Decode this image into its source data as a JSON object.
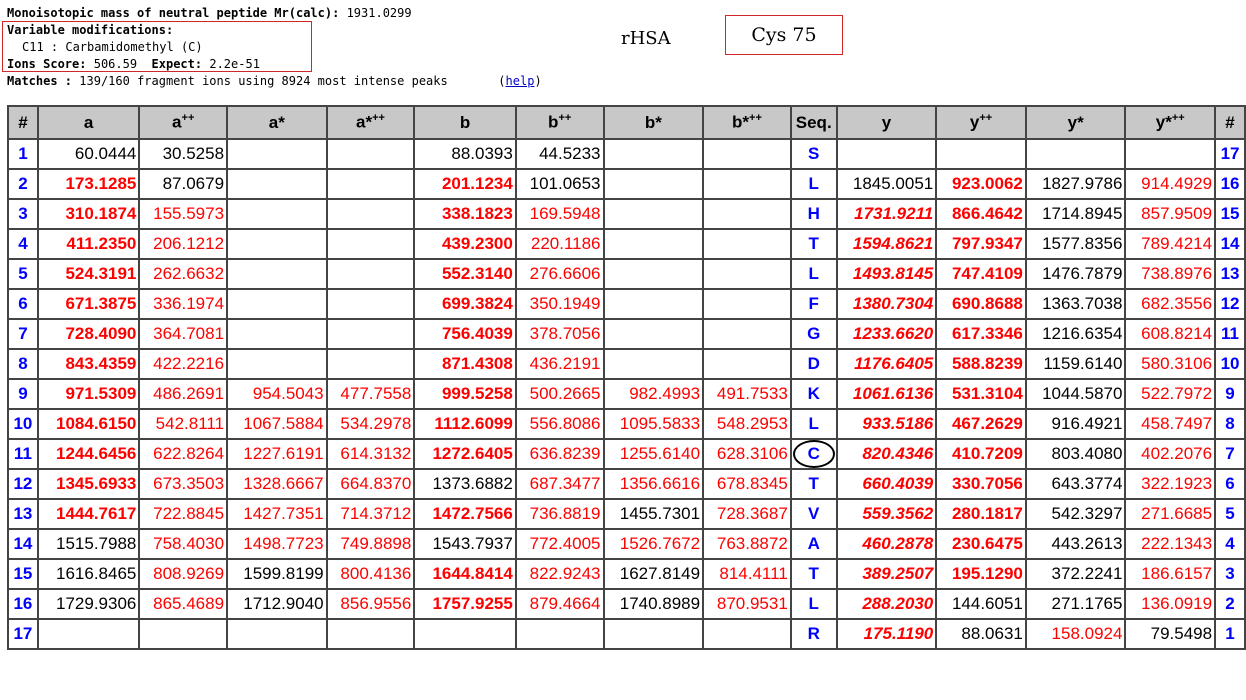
{
  "header": {
    "mass_label": "Monoisotopic mass of neutral peptide Mr(calc):",
    "mass_value": "1931.0299",
    "varmod_label": "Variable modifications:",
    "varmod_value": "C11 : Carbamidomethyl (C)",
    "score_label": "Ions Score:",
    "score_value": "506.59",
    "expect_label": "Expect:",
    "expect_value": "2.2e-51",
    "matches_label": "Matches :",
    "matches_value": "139/160 fragment ions using 8924 most intense peaks",
    "help_link": "help"
  },
  "protein_label": "rHSA",
  "site_label": "Cys 75",
  "accent_color": "#ff0000",
  "index_color": "#0000ff",
  "table": {
    "columns": [
      "#",
      "a",
      "a++",
      "a*",
      "a***",
      "b",
      "b++",
      "b*",
      "b***",
      "Seq.",
      "y",
      "y++",
      "y*",
      "y***",
      "#"
    ],
    "rows": [
      {
        "n": "1",
        "a": "60.0444",
        "a2": "30.5258",
        "as": "",
        "a3": "",
        "b": "88.0393",
        "b2": "44.5233",
        "bs": "",
        "b3": "",
        "seq": "S",
        "y": "",
        "y2": "",
        "ys": "",
        "y3": "",
        "n2": "17"
      },
      {
        "n": "2",
        "a": "173.1285",
        "a2": "87.0679",
        "as": "",
        "a3": "",
        "b": "201.1234",
        "b2": "101.0653",
        "bs": "",
        "b3": "",
        "seq": "L",
        "y": "1845.0051",
        "y2": "923.0062",
        "ys": "1827.9786",
        "y3": "914.4929",
        "n2": "16"
      },
      {
        "n": "3",
        "a": "310.1874",
        "a2": "155.5973",
        "as": "",
        "a3": "",
        "b": "338.1823",
        "b2": "169.5948",
        "bs": "",
        "b3": "",
        "seq": "H",
        "y": "1731.9211",
        "y2": "866.4642",
        "ys": "1714.8945",
        "y3": "857.9509",
        "n2": "15"
      },
      {
        "n": "4",
        "a": "411.2350",
        "a2": "206.1212",
        "as": "",
        "a3": "",
        "b": "439.2300",
        "b2": "220.1186",
        "bs": "",
        "b3": "",
        "seq": "T",
        "y": "1594.8621",
        "y2": "797.9347",
        "ys": "1577.8356",
        "y3": "789.4214",
        "n2": "14"
      },
      {
        "n": "5",
        "a": "524.3191",
        "a2": "262.6632",
        "as": "",
        "a3": "",
        "b": "552.3140",
        "b2": "276.6606",
        "bs": "",
        "b3": "",
        "seq": "L",
        "y": "1493.8145",
        "y2": "747.4109",
        "ys": "1476.7879",
        "y3": "738.8976",
        "n2": "13"
      },
      {
        "n": "6",
        "a": "671.3875",
        "a2": "336.1974",
        "as": "",
        "a3": "",
        "b": "699.3824",
        "b2": "350.1949",
        "bs": "",
        "b3": "",
        "seq": "F",
        "y": "1380.7304",
        "y2": "690.8688",
        "ys": "1363.7038",
        "y3": "682.3556",
        "n2": "12"
      },
      {
        "n": "7",
        "a": "728.4090",
        "a2": "364.7081",
        "as": "",
        "a3": "",
        "b": "756.4039",
        "b2": "378.7056",
        "bs": "",
        "b3": "",
        "seq": "G",
        "y": "1233.6620",
        "y2": "617.3346",
        "ys": "1216.6354",
        "y3": "608.8214",
        "n2": "11"
      },
      {
        "n": "8",
        "a": "843.4359",
        "a2": "422.2216",
        "as": "",
        "a3": "",
        "b": "871.4308",
        "b2": "436.2191",
        "bs": "",
        "b3": "",
        "seq": "D",
        "y": "1176.6405",
        "y2": "588.8239",
        "ys": "1159.6140",
        "y3": "580.3106",
        "n2": "10"
      },
      {
        "n": "9",
        "a": "971.5309",
        "a2": "486.2691",
        "as": "954.5043",
        "a3": "477.7558",
        "b": "999.5258",
        "b2": "500.2665",
        "bs": "982.4993",
        "b3": "491.7533",
        "seq": "K",
        "y": "1061.6136",
        "y2": "531.3104",
        "ys": "1044.5870",
        "y3": "522.7972",
        "n2": "9"
      },
      {
        "n": "10",
        "a": "1084.6150",
        "a2": "542.8111",
        "as": "1067.5884",
        "a3": "534.2978",
        "b": "1112.6099",
        "b2": "556.8086",
        "bs": "1095.5833",
        "b3": "548.2953",
        "seq": "L",
        "y": "933.5186",
        "y2": "467.2629",
        "ys": "916.4921",
        "y3": "458.7497",
        "n2": "8"
      },
      {
        "n": "11",
        "a": "1244.6456",
        "a2": "622.8264",
        "as": "1227.6191",
        "a3": "614.3132",
        "b": "1272.6405",
        "b2": "636.8239",
        "bs": "1255.6140",
        "b3": "628.3106",
        "seq": "C",
        "y": "820.4346",
        "y2": "410.7209",
        "ys": "803.4080",
        "y3": "402.2076",
        "n2": "7"
      },
      {
        "n": "12",
        "a": "1345.6933",
        "a2": "673.3503",
        "as": "1328.6667",
        "a3": "664.8370",
        "b": "1373.6882",
        "b2": "687.3477",
        "bs": "1356.6616",
        "b3": "678.8345",
        "seq": "T",
        "y": "660.4039",
        "y2": "330.7056",
        "ys": "643.3774",
        "y3": "322.1923",
        "n2": "6"
      },
      {
        "n": "13",
        "a": "1444.7617",
        "a2": "722.8845",
        "as": "1427.7351",
        "a3": "714.3712",
        "b": "1472.7566",
        "b2": "736.8819",
        "bs": "1455.7301",
        "b3": "728.3687",
        "seq": "V",
        "y": "559.3562",
        "y2": "280.1817",
        "ys": "542.3297",
        "y3": "271.6685",
        "n2": "5"
      },
      {
        "n": "14",
        "a": "1515.7988",
        "a2": "758.4030",
        "as": "1498.7723",
        "a3": "749.8898",
        "b": "1543.7937",
        "b2": "772.4005",
        "bs": "1526.7672",
        "b3": "763.8872",
        "seq": "A",
        "y": "460.2878",
        "y2": "230.6475",
        "ys": "443.2613",
        "y3": "222.1343",
        "n2": "4"
      },
      {
        "n": "15",
        "a": "1616.8465",
        "a2": "808.9269",
        "as": "1599.8199",
        "a3": "800.4136",
        "b": "1644.8414",
        "b2": "822.9243",
        "bs": "1627.8149",
        "b3": "814.4111",
        "seq": "T",
        "y": "389.2507",
        "y2": "195.1290",
        "ys": "372.2241",
        "y3": "186.6157",
        "n2": "3"
      },
      {
        "n": "16",
        "a": "1729.9306",
        "a2": "865.4689",
        "as": "1712.9040",
        "a3": "856.9556",
        "b": "1757.9255",
        "b2": "879.4664",
        "bs": "1740.8989",
        "b3": "870.9531",
        "seq": "L",
        "y": "288.2030",
        "y2": "144.6051",
        "ys": "271.1765",
        "y3": "136.0919",
        "n2": "2"
      },
      {
        "n": "17",
        "a": "",
        "a2": "",
        "as": "",
        "a3": "",
        "b": "",
        "b2": "",
        "bs": "",
        "b3": "",
        "seq": "R",
        "y": "175.1190",
        "y2": "88.0631",
        "ys": "158.0924",
        "y3": "79.5498",
        "n2": "1"
      }
    ]
  }
}
